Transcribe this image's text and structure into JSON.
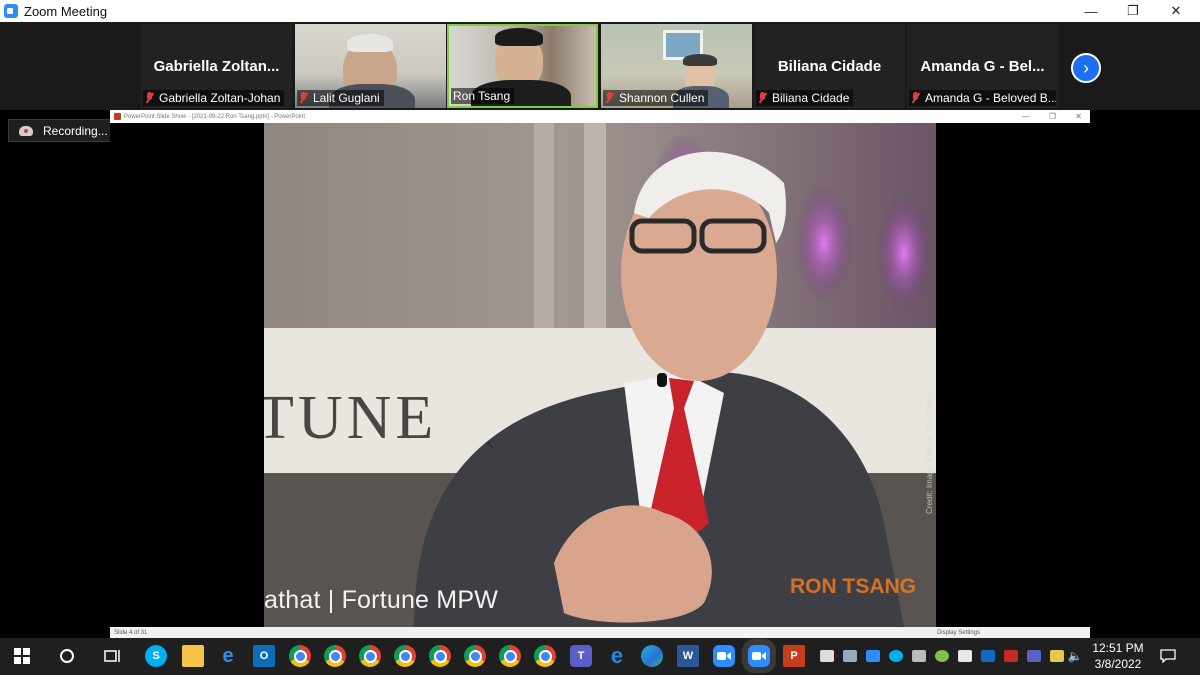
{
  "window": {
    "title": "Zoom Meeting"
  },
  "gallery": {
    "tiles": [
      {
        "display_name": "Gabriella  Zoltan...",
        "label": "Gabriella Zoltan-Johan",
        "video": false
      },
      {
        "display_name": "",
        "label": "Lalit Guglani",
        "video": true
      },
      {
        "display_name": "",
        "label": "Ron Tsang",
        "video": true,
        "active_speaker": true
      },
      {
        "display_name": "",
        "label": "Shannon Cullen",
        "video": true
      },
      {
        "display_name": "Biliana Cidade",
        "label": "Biliana Cidade",
        "video": false
      },
      {
        "display_name": "Amanda G - Bel...",
        "label": "Amanda G - Beloved B...",
        "video": false
      }
    ],
    "next_icon": "chevron-right-icon"
  },
  "recording": {
    "label": "Recording..."
  },
  "share": {
    "ppt_title": "PowerPoint Slide Show - [2021-09-22 Ron Tsang.pptx] - PowerPoint",
    "slide_status": "Slide 4 of 31",
    "display_settings": "Display Settings",
    "slide": {
      "caption": "athat | Fortune MPW",
      "watermark": "RON TSANG",
      "credit": "Credit: Image: Fortune Live Media",
      "backdrop_text": "TUNE"
    }
  },
  "taskbar": {
    "icons": [
      "windows-start-icon",
      "cortana-icon",
      "task-view-icon",
      "skype-icon",
      "file-explorer-icon",
      "internet-explorer-icon",
      "outlook-icon",
      "chrome-icon",
      "chrome-icon",
      "chrome-icon",
      "chrome-icon",
      "chrome-icon",
      "chrome-icon",
      "chrome-icon",
      "chrome-icon",
      "teams-icon",
      "edge-legacy-icon",
      "edge-icon",
      "word-icon",
      "zoom-icon",
      "zoom-icon",
      "powerpoint-icon"
    ],
    "clock": {
      "time": "12:51 PM",
      "date": "3/8/2022"
    }
  },
  "colors": {
    "accent": "#2d8cff",
    "muted_mic": "#e0403a",
    "active_speaker_border": "#7fce3b",
    "watermark": "#f07a1a"
  }
}
